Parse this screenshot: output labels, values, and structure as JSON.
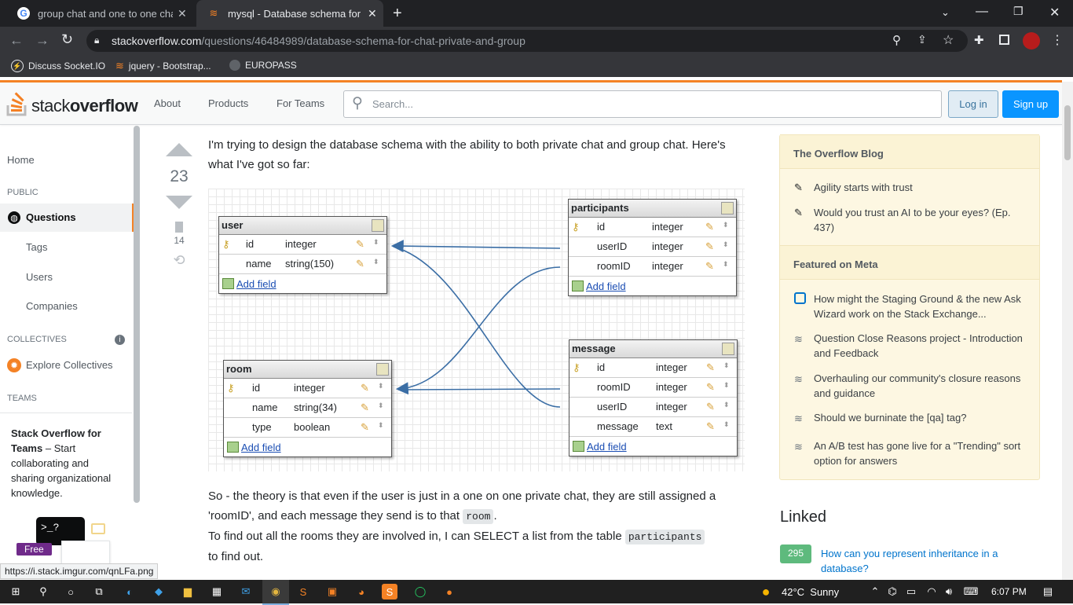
{
  "browser": {
    "tabs": [
      {
        "title": "group chat and one to one chat"
      },
      {
        "title": "mysql - Database schema for cha"
      }
    ],
    "url_host": "stackoverflow.com",
    "url_path": "/questions/46484989/database-schema-for-chat-private-and-group",
    "bookmarks": [
      "Discuss Socket.IO",
      "jquery - Bootstrap...",
      "EUROPASS"
    ]
  },
  "header": {
    "logo_a": "stack",
    "logo_b": "overflow",
    "nav": [
      "About",
      "Products",
      "For Teams"
    ],
    "search_placeholder": "Search...",
    "login": "Log in",
    "signup": "Sign up"
  },
  "leftnav": {
    "home": "Home",
    "public": "PUBLIC",
    "questions": "Questions",
    "tags": "Tags",
    "users": "Users",
    "companies": "Companies",
    "collectives": "COLLECTIVES",
    "explore": "Explore Collectives",
    "teams": "TEAMS",
    "teams_title": "Stack Overflow for Teams",
    "teams_text": " – Start collaborating and sharing organizational knowledge.",
    "free": "Free"
  },
  "vote": {
    "score": "23",
    "bookmarks": "14"
  },
  "question": {
    "p1": "I'm trying to design the database schema with the ability to both private chat and group chat. Here's what I've got so far:",
    "p2a": "So - the theory is that even if the user is just in a one on one private chat, they are still assigned a 'roomID', and each message they send is to that ",
    "p2code": "room",
    "p2b": ".",
    "p3a": "To find out all the rooms they are involved in, I can SELECT a list from the table ",
    "p3code": "participants",
    "p3b": "to find out."
  },
  "diagram": {
    "add_field": "Add field",
    "tables": [
      {
        "name": "user",
        "rows": [
          [
            "id",
            "integer"
          ],
          [
            "name",
            "string(150)"
          ]
        ]
      },
      {
        "name": "participants",
        "rows": [
          [
            "id",
            "integer"
          ],
          [
            "userID",
            "integer"
          ],
          [
            "roomID",
            "integer"
          ]
        ]
      },
      {
        "name": "room",
        "rows": [
          [
            "id",
            "integer"
          ],
          [
            "name",
            "string(34)"
          ],
          [
            "type",
            "boolean"
          ]
        ]
      },
      {
        "name": "message",
        "rows": [
          [
            "id",
            "integer"
          ],
          [
            "roomID",
            "integer"
          ],
          [
            "userID",
            "integer"
          ],
          [
            "message",
            "text"
          ]
        ]
      }
    ]
  },
  "sidebar": {
    "blog_title": "The Overflow Blog",
    "blog_items": [
      "Agility starts with trust",
      "Would you trust an AI to be your eyes? (Ep. 437)"
    ],
    "meta_title": "Featured on Meta",
    "meta_items": [
      "How might the Staging Ground & the new Ask Wizard work on the Stack Exchange...",
      "Question Close Reasons project - Introduction and Feedback",
      "Overhauling our community's closure reasons and guidance",
      "Should we burninate the [qa] tag?",
      "An A/B test has gone live for a \"Trending\" sort option for answers"
    ],
    "linked_title": "Linked",
    "linked_count": "295",
    "linked_text": "How can you represent inheritance in a database?"
  },
  "statusbar": {
    "link": "https://i.stack.imgur.com/qnLFa.png"
  },
  "taskbar": {
    "weather": "42°C  Sunny",
    "time": "6:07 PM"
  },
  "colors": {
    "accent": "#f48225",
    "link": "#0074cc",
    "blue_button": "#0a95ff"
  }
}
